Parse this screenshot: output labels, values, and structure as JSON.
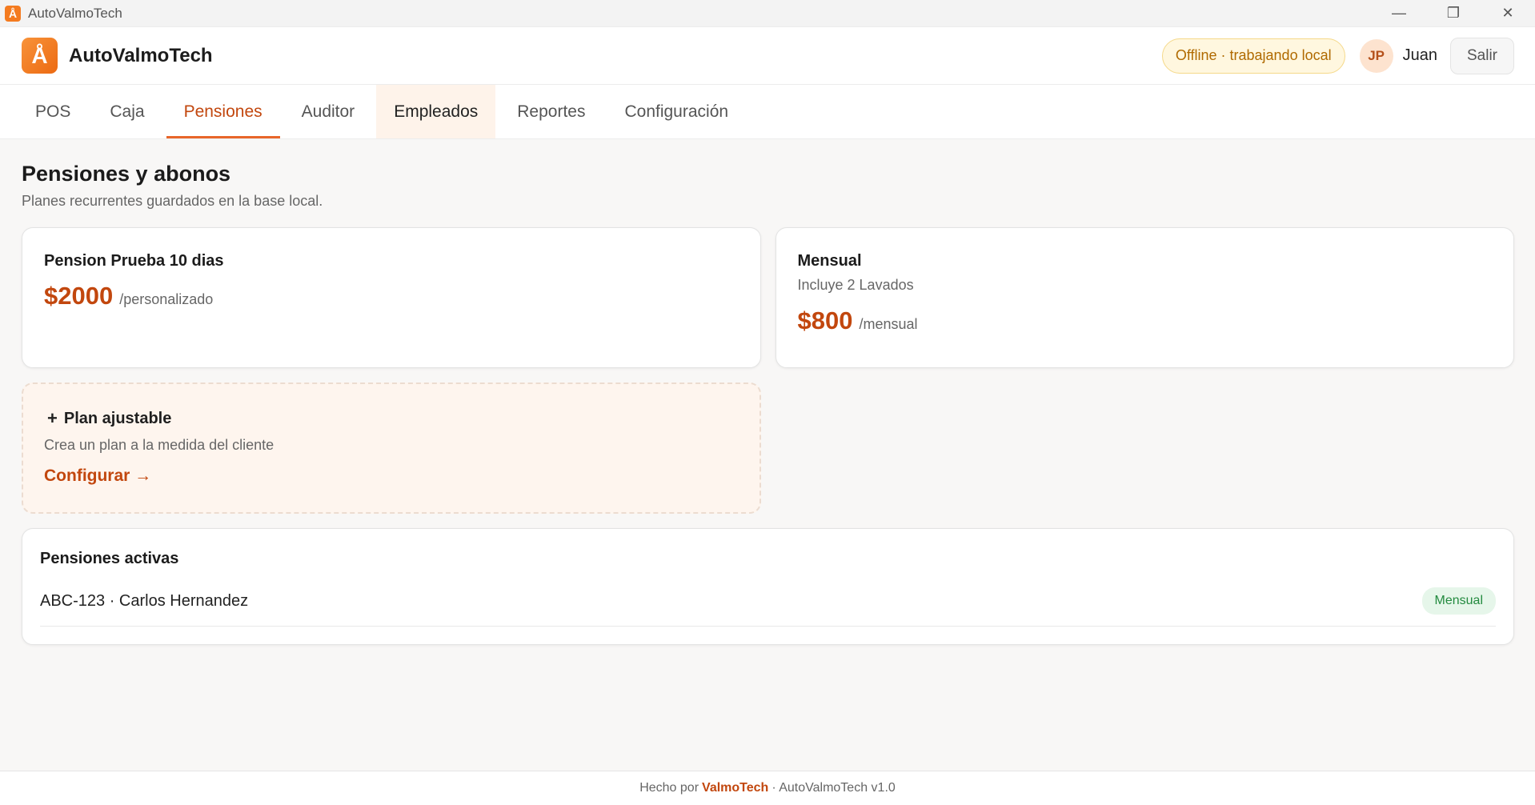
{
  "window": {
    "title": "AutoValmoTech",
    "app_icon_letter": "Å",
    "controls": {
      "minimize": "—",
      "restore": "❐",
      "close": "✕"
    }
  },
  "header": {
    "logo_letter": "Å",
    "brand": "AutoValmoTech",
    "status_badge": "Offline · trabajando local",
    "avatar_initials": "JP",
    "user_name": "Juan",
    "logout_label": "Salir"
  },
  "tabs": [
    {
      "label": "POS"
    },
    {
      "label": "Caja"
    },
    {
      "label": "Pensiones",
      "active": true
    },
    {
      "label": "Auditor"
    },
    {
      "label": "Empleados",
      "hover": true
    },
    {
      "label": "Reportes"
    },
    {
      "label": "Configuración"
    }
  ],
  "page": {
    "title": "Pensiones y abonos",
    "subtitle": "Planes recurrentes guardados en la base local."
  },
  "plans": [
    {
      "title": "Pension Prueba 10 dias",
      "description": "",
      "price": "$2000",
      "period": "/personalizado"
    },
    {
      "title": "Mensual",
      "description": "Incluye 2 Lavados",
      "price": "$800",
      "period": "/mensual"
    }
  ],
  "custom_plan": {
    "plus": "+",
    "title": "Plan ajustable",
    "description": "Crea un plan a la medida del cliente",
    "action": "Configurar →"
  },
  "active_pensions": {
    "title": "Pensiones activas",
    "rows": [
      {
        "who": "ABC-123 · Carlos Hernandez",
        "plan": "Mensual"
      }
    ]
  },
  "footer": {
    "prefix": "Hecho por",
    "company": "ValmoTech",
    "suffix": "· AutoValmoTech v1.0"
  },
  "colors": {
    "accent": "#c2470e",
    "brand_orange": "#f47b20",
    "status_warning": "#b06a00",
    "success": "#238a3f"
  }
}
